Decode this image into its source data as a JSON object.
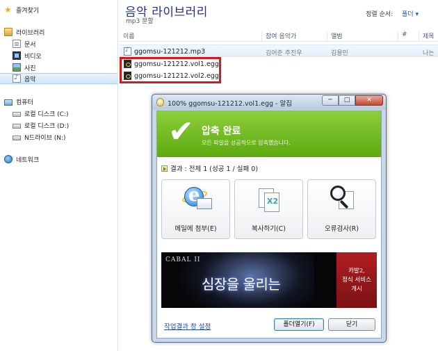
{
  "nav": {
    "favorites": "즐겨찾기",
    "library": "라이브러리",
    "documents": "문서",
    "videos": "비디오",
    "pictures": "사진",
    "music": "음악",
    "computer": "컴퓨터",
    "drive_c": "로컬 디스크 (C:)",
    "drive_d": "로컬 디스크 (D:)",
    "drive_n": "N드라이브 (N:)",
    "network": "네트워크"
  },
  "header": {
    "title": "음악 라이브러리",
    "subtitle": "mp3 분할",
    "arrange_label": "정렬 순서:",
    "arrange_value": "폴더 ▾"
  },
  "columns": [
    "이름",
    "참여 음악가",
    "앨범",
    "#",
    "제목"
  ],
  "files": [
    {
      "name": "ggomsu-121212.mp3",
      "artist": "김어준 주진우",
      "album": "김용민",
      "title": "나는"
    },
    {
      "name": "ggomsu-121212.vol1.egg",
      "artist": "",
      "album": "",
      "title": ""
    },
    {
      "name": "ggomsu-121212.vol2.egg",
      "artist": "",
      "album": "",
      "title": ""
    }
  ],
  "dialog": {
    "title": "100% ggomsu-121212.vol1.egg - 알집",
    "window_buttons": {
      "minimize": "─",
      "maximize": "□",
      "close": "✕"
    },
    "status_title": "압축 완료",
    "status_subtitle": "모든 파일을 성공적으로 압축했습니다.",
    "result": "결과 : 전체 1 (성공 1 / 실패 0)",
    "actions": {
      "mail": "메일에 첨부(E)",
      "copy": "복사하기(C)",
      "error_check": "오류검사(R)"
    },
    "ad": {
      "logo": "CABAL II",
      "slogan": "심장을 울리는",
      "side_line1": "카발2,",
      "side_line2": "정식 서비스",
      "side_line3": "개시"
    },
    "settings_link": "작업결과 창 설정",
    "open_folder": "폴더열기(F)",
    "close": "닫기"
  }
}
